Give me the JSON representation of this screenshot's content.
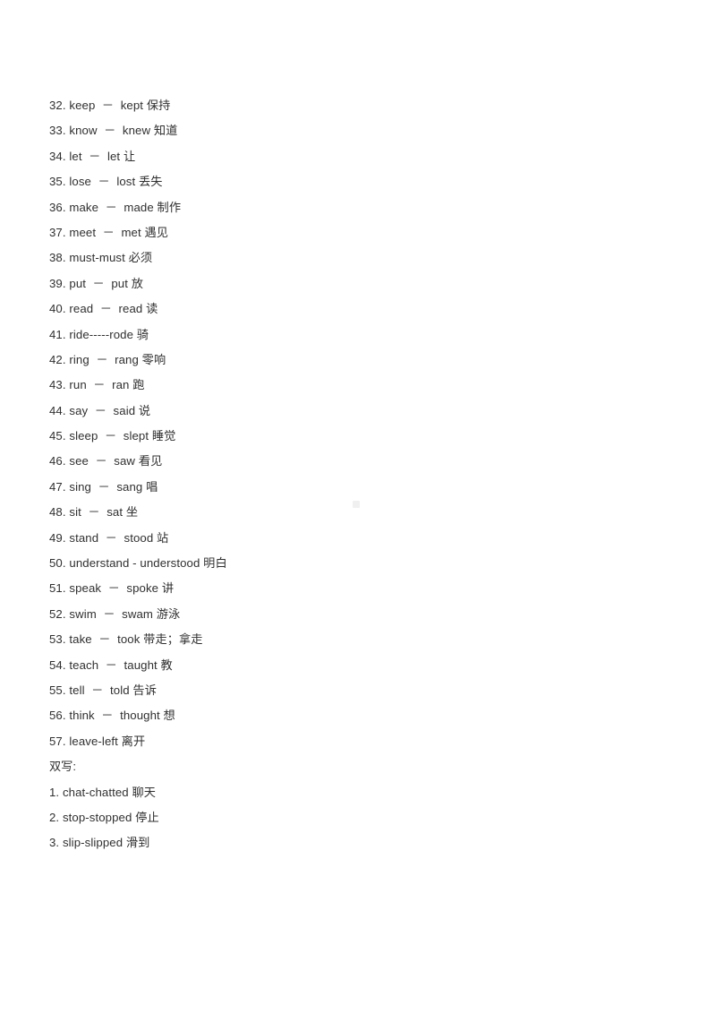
{
  "document": {
    "text_color": "#303030",
    "background_color": "#ffffff",
    "verb_list": [
      "32. keep  －  kept 保持",
      "33. know  －  knew 知道",
      "34. let  －  let 让",
      "35. lose  －  lost 丢失",
      "36. make  －  made 制作",
      "37. meet  －  met 遇见",
      "38. must-must 必须",
      "39. put  －  put 放",
      "40. read  －  read 读",
      "41. ride-----rode 骑",
      "42. ring  －  rang 零响",
      "43. run  －  ran 跑",
      "44. say  －  said 说",
      "45. sleep  －  slept 睡觉",
      "46. see  －  saw 看见",
      "47. sing  －  sang 唱",
      "48. sit  －  sat 坐",
      "49. stand  －  stood 站",
      "50. understand - understood 明白",
      "51. speak  －  spoke 讲",
      "52. swim  －  swam 游泳",
      "53. take  －  took 带走；拿走",
      "54. teach  －  taught 教",
      "55. tell  －  told 告诉",
      "56. think  －  thought 想",
      "57. leave-left 离开"
    ],
    "double_letter_heading": "双写:",
    "double_letter_list": [
      "1. chat-chatted 聊天",
      "2. stop-stopped 停止",
      "3. slip-slipped 滑到"
    ]
  }
}
